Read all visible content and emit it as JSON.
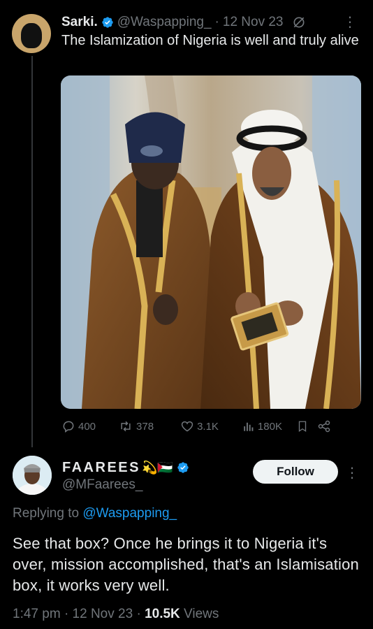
{
  "tweet1": {
    "name": "Sarki.",
    "handle": "@Waspapping_",
    "separator": "·",
    "date": "12 Nov 23",
    "text": "The Islamization of Nigeria is well and truly alive",
    "more_icon": "more-icon",
    "stats": {
      "replies": "400",
      "retweets": "378",
      "likes": "3.1K",
      "views": "180K"
    }
  },
  "tweet2": {
    "name": "FAAREES",
    "name_emojis": "💫🇵🇸",
    "handle": "@MFaarees_",
    "follow_label": "Follow",
    "replying_prefix": "Replying to",
    "replying_to": "@Waspapping_",
    "text": "See that box? Once he brings it to Nigeria it's over, mission accomplished, that's an Islamisation box, it works very well.",
    "time": "1:47 pm",
    "separator": "·",
    "date": "12 Nov 23",
    "views_count": "10.5K",
    "views_label": "Views"
  },
  "colors": {
    "background": "#000000",
    "text": "#e7e9ea",
    "muted": "#71767b",
    "accent": "#1d9bf0",
    "verified": "#1d9bf0"
  }
}
